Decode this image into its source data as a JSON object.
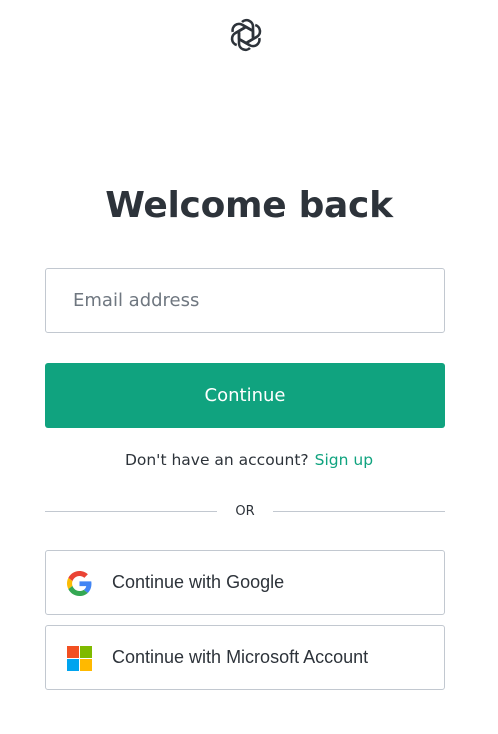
{
  "logo": {
    "icon": "openai-logo-icon"
  },
  "heading": {
    "title": "Welcome back"
  },
  "login_form": {
    "email_placeholder": "Email address",
    "email_value": "",
    "continue_label": "Continue"
  },
  "signup": {
    "prompt": "Don't have an account?",
    "link_label": "Sign up"
  },
  "divider": {
    "label": "OR"
  },
  "social": [
    {
      "label": "Continue with Google",
      "icon": "google-icon"
    },
    {
      "label": "Continue with Microsoft Account",
      "icon": "microsoft-icon"
    }
  ],
  "colors": {
    "accent": "#10a37f",
    "text": "#2d333a",
    "border": "#c2c8d0",
    "placeholder": "#6f7780"
  }
}
